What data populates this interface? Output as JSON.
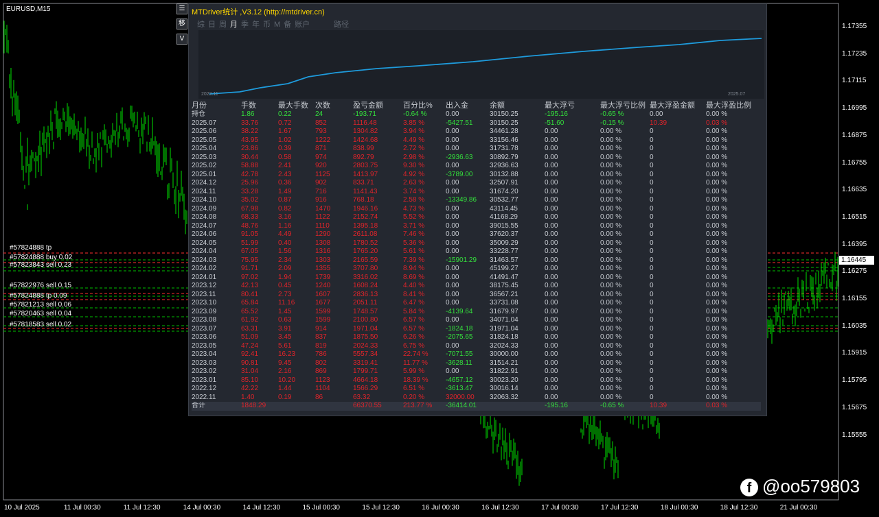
{
  "chart": {
    "symbol": "EURUSD,M15",
    "current_price": "1.16445",
    "price_ticks": [
      "1.17355",
      "1.17235",
      "1.17115",
      "1.16995",
      "1.16875",
      "1.16755",
      "1.16635",
      "1.16515",
      "1.16395",
      "1.16275",
      "1.16155",
      "1.16035",
      "1.15915",
      "1.15795",
      "1.15675",
      "1.15555"
    ],
    "time_ticks": [
      "10 Jul 2025",
      "11 Jul 00:30",
      "11 Jul 12:30",
      "14 Jul 00:30",
      "14 Jul 12:30",
      "15 Jul 00:30",
      "15 Jul 12:30",
      "16 Jul 00:30",
      "16 Jul 12:30",
      "17 Jul 00:30",
      "17 Jul 12:30",
      "18 Jul 00:30",
      "18 Jul 12:30",
      "21 Jul 00:30"
    ],
    "order_labels": [
      "#57824888 tp",
      "#57824888 buy 0.02",
      "#57823843 sell 0.23",
      "#57822976 sell 0.15",
      "#57824888 tp 0.09",
      "#57821213 sell 0.06",
      "#57820463 sell 0.04",
      "#57818583 sell 0.02"
    ],
    "side_buttons": [
      "☰",
      "移",
      "V"
    ],
    "bullish_color": "#00e000",
    "level_color_sell": "#ff3030",
    "level_color_tp": "#00c000"
  },
  "panel": {
    "title": "MTDriver统计 ,V3.12 (http://mtdriver.cn)",
    "tabs": [
      "综",
      "日",
      "周",
      "月",
      "季",
      "年",
      "币",
      "M",
      "备",
      "账户",
      "",
      "路径"
    ],
    "active_tab": "月",
    "mini_chart": {
      "start_label": "2022.11",
      "end_label": "2025.07",
      "line_color": "#1e9bdc"
    },
    "headers": [
      "月份",
      "手数",
      "最大手数",
      "次数",
      "盈亏金额",
      "百分比%",
      "出入金",
      "余额",
      "最大浮亏",
      "最大浮亏比例",
      "最大浮盈金额",
      "最大浮盈比例"
    ],
    "rows": [
      {
        "cells": [
          "持仓",
          "1.86",
          "0.22",
          "24",
          "-193.71",
          "-0.64 %",
          "0.00",
          "30150.25",
          "-195.16",
          "-0.65 %",
          "0.00",
          "0.00 %"
        ],
        "colors": [
          "w",
          "g",
          "g",
          "g",
          "g",
          "g",
          "w",
          "w",
          "g",
          "g",
          "w",
          "w"
        ]
      },
      {
        "cells": [
          "2025.07",
          "33.76",
          "0.72",
          "852",
          "1116.48",
          "3.85 %",
          "-5427.51",
          "30150.25",
          "-51.60",
          "-0.15 %",
          "10.39",
          "0.03 %"
        ],
        "colors": [
          "w",
          "r",
          "r",
          "r",
          "r",
          "r",
          "g",
          "w",
          "g",
          "g",
          "r",
          "r"
        ]
      },
      {
        "cells": [
          "2025.06",
          "38.22",
          "1.67",
          "793",
          "1304.82",
          "3.94 %",
          "0.00",
          "34461.28",
          "0.00",
          "0.00 %",
          "0",
          "0.00 %"
        ],
        "colors": [
          "w",
          "r",
          "r",
          "r",
          "r",
          "r",
          "w",
          "w",
          "w",
          "w",
          "w",
          "w"
        ]
      },
      {
        "cells": [
          "2025.05",
          "43.95",
          "1.02",
          "1222",
          "1424.68",
          "4.49 %",
          "0.00",
          "33156.46",
          "0.00",
          "0.00 %",
          "0",
          "0.00 %"
        ],
        "colors": [
          "w",
          "r",
          "r",
          "r",
          "r",
          "r",
          "w",
          "w",
          "w",
          "w",
          "w",
          "w"
        ]
      },
      {
        "cells": [
          "2025.04",
          "23.86",
          "0.39",
          "871",
          "838.99",
          "2.72 %",
          "0.00",
          "31731.78",
          "0.00",
          "0.00 %",
          "0",
          "0.00 %"
        ],
        "colors": [
          "w",
          "r",
          "r",
          "r",
          "r",
          "r",
          "w",
          "w",
          "w",
          "w",
          "w",
          "w"
        ]
      },
      {
        "cells": [
          "2025.03",
          "30.44",
          "0.58",
          "974",
          "892.79",
          "2.98 %",
          "-2936.63",
          "30892.79",
          "0.00",
          "0.00 %",
          "0",
          "0.00 %"
        ],
        "colors": [
          "w",
          "r",
          "r",
          "r",
          "r",
          "r",
          "g",
          "w",
          "w",
          "w",
          "w",
          "w"
        ]
      },
      {
        "cells": [
          "2025.02",
          "58.88",
          "2.41",
          "920",
          "2803.75",
          "9.30 %",
          "0.00",
          "32936.63",
          "0.00",
          "0.00 %",
          "0",
          "0.00 %"
        ],
        "colors": [
          "w",
          "r",
          "r",
          "r",
          "r",
          "r",
          "w",
          "w",
          "w",
          "w",
          "w",
          "w"
        ]
      },
      {
        "cells": [
          "2025.01",
          "42.78",
          "2.43",
          "1125",
          "1413.97",
          "4.92 %",
          "-3789.00",
          "30132.88",
          "0.00",
          "0.00 %",
          "0",
          "0.00 %"
        ],
        "colors": [
          "w",
          "r",
          "r",
          "r",
          "r",
          "r",
          "g",
          "w",
          "w",
          "w",
          "w",
          "w"
        ]
      },
      {
        "cells": [
          "2024.12",
          "25.96",
          "0.36",
          "902",
          "833.71",
          "2.63 %",
          "0.00",
          "32507.91",
          "0.00",
          "0.00 %",
          "0",
          "0.00 %"
        ],
        "colors": [
          "w",
          "r",
          "r",
          "r",
          "r",
          "r",
          "w",
          "w",
          "w",
          "w",
          "w",
          "w"
        ]
      },
      {
        "cells": [
          "2024.11",
          "33.28",
          "1.49",
          "716",
          "1141.43",
          "3.74 %",
          "0.00",
          "31674.20",
          "0.00",
          "0.00 %",
          "0",
          "0.00 %"
        ],
        "colors": [
          "w",
          "r",
          "r",
          "r",
          "r",
          "r",
          "w",
          "w",
          "w",
          "w",
          "w",
          "w"
        ]
      },
      {
        "cells": [
          "2024.10",
          "35.02",
          "0.87",
          "916",
          "768.18",
          "2.58 %",
          "-13349.86",
          "30532.77",
          "0.00",
          "0.00 %",
          "0",
          "0.00 %"
        ],
        "colors": [
          "w",
          "r",
          "r",
          "r",
          "r",
          "r",
          "g",
          "w",
          "w",
          "w",
          "w",
          "w"
        ]
      },
      {
        "cells": [
          "2024.09",
          "67.98",
          "0.82",
          "1470",
          "1946.16",
          "4.73 %",
          "0.00",
          "43114.45",
          "0.00",
          "0.00 %",
          "0",
          "0.00 %"
        ],
        "colors": [
          "w",
          "r",
          "r",
          "r",
          "r",
          "r",
          "w",
          "w",
          "w",
          "w",
          "w",
          "w"
        ]
      },
      {
        "cells": [
          "2024.08",
          "68.33",
          "3.16",
          "1122",
          "2152.74",
          "5.52 %",
          "0.00",
          "41168.29",
          "0.00",
          "0.00 %",
          "0",
          "0.00 %"
        ],
        "colors": [
          "w",
          "r",
          "r",
          "r",
          "r",
          "r",
          "w",
          "w",
          "w",
          "w",
          "w",
          "w"
        ]
      },
      {
        "cells": [
          "2024.07",
          "48.76",
          "1.16",
          "1110",
          "1395.18",
          "3.71 %",
          "0.00",
          "39015.55",
          "0.00",
          "0.00 %",
          "0",
          "0.00 %"
        ],
        "colors": [
          "w",
          "r",
          "r",
          "r",
          "r",
          "r",
          "w",
          "w",
          "w",
          "w",
          "w",
          "w"
        ]
      },
      {
        "cells": [
          "2024.06",
          "91.05",
          "4.49",
          "1290",
          "2611.08",
          "7.46 %",
          "0.00",
          "37620.37",
          "0.00",
          "0.00 %",
          "0",
          "0.00 %"
        ],
        "colors": [
          "w",
          "r",
          "r",
          "r",
          "r",
          "r",
          "w",
          "w",
          "w",
          "w",
          "w",
          "w"
        ]
      },
      {
        "cells": [
          "2024.05",
          "51.99",
          "0.40",
          "1308",
          "1780.52",
          "5.36 %",
          "0.00",
          "35009.29",
          "0.00",
          "0.00 %",
          "0",
          "0.00 %"
        ],
        "colors": [
          "w",
          "r",
          "r",
          "r",
          "r",
          "r",
          "w",
          "w",
          "w",
          "w",
          "w",
          "w"
        ]
      },
      {
        "cells": [
          "2024.04",
          "67.05",
          "1.56",
          "1316",
          "1765.20",
          "5.61 %",
          "0.00",
          "33228.77",
          "0.00",
          "0.00 %",
          "0",
          "0.00 %"
        ],
        "colors": [
          "w",
          "r",
          "r",
          "r",
          "r",
          "r",
          "w",
          "w",
          "w",
          "w",
          "w",
          "w"
        ]
      },
      {
        "cells": [
          "2024.03",
          "75.95",
          "2.34",
          "1303",
          "2165.59",
          "7.39 %",
          "-15901.29",
          "31463.57",
          "0.00",
          "0.00 %",
          "0",
          "0.00 %"
        ],
        "colors": [
          "w",
          "r",
          "r",
          "r",
          "r",
          "r",
          "g",
          "w",
          "w",
          "w",
          "w",
          "w"
        ]
      },
      {
        "cells": [
          "2024.02",
          "91.71",
          "2.09",
          "1355",
          "3707.80",
          "8.94 %",
          "0.00",
          "45199.27",
          "0.00",
          "0.00 %",
          "0",
          "0.00 %"
        ],
        "colors": [
          "w",
          "r",
          "r",
          "r",
          "r",
          "r",
          "w",
          "w",
          "w",
          "w",
          "w",
          "w"
        ]
      },
      {
        "cells": [
          "2024.01",
          "97.02",
          "1.94",
          "1739",
          "3316.02",
          "8.69 %",
          "0.00",
          "41491.47",
          "0.00",
          "0.00 %",
          "0",
          "0.00 %"
        ],
        "colors": [
          "w",
          "r",
          "r",
          "r",
          "r",
          "r",
          "w",
          "w",
          "w",
          "w",
          "w",
          "w"
        ]
      },
      {
        "cells": [
          "2023.12",
          "42.13",
          "0.45",
          "1240",
          "1608.24",
          "4.40 %",
          "0.00",
          "38175.45",
          "0.00",
          "0.00 %",
          "0",
          "0.00 %"
        ],
        "colors": [
          "w",
          "r",
          "r",
          "r",
          "r",
          "r",
          "w",
          "w",
          "w",
          "w",
          "w",
          "w"
        ]
      },
      {
        "cells": [
          "2023.11",
          "80.41",
          "2.73",
          "1607",
          "2836.13",
          "8.41 %",
          "0.00",
          "36567.21",
          "0.00",
          "0.00 %",
          "0",
          "0.00 %"
        ],
        "colors": [
          "w",
          "r",
          "r",
          "r",
          "r",
          "r",
          "w",
          "w",
          "w",
          "w",
          "w",
          "w"
        ]
      },
      {
        "cells": [
          "2023.10",
          "65.84",
          "11.16",
          "1677",
          "2051.11",
          "6.47 %",
          "0.00",
          "33731.08",
          "0.00",
          "0.00 %",
          "0",
          "0.00 %"
        ],
        "colors": [
          "w",
          "r",
          "r",
          "r",
          "r",
          "r",
          "w",
          "w",
          "w",
          "w",
          "w",
          "w"
        ]
      },
      {
        "cells": [
          "2023.09",
          "65.52",
          "1.45",
          "1599",
          "1748.57",
          "5.84 %",
          "-4139.64",
          "31679.97",
          "0.00",
          "0.00 %",
          "0",
          "0.00 %"
        ],
        "colors": [
          "w",
          "r",
          "r",
          "r",
          "r",
          "r",
          "g",
          "w",
          "w",
          "w",
          "w",
          "w"
        ]
      },
      {
        "cells": [
          "2023.08",
          "61.92",
          "0.63",
          "1599",
          "2100.80",
          "6.57 %",
          "0.00",
          "34071.04",
          "0.00",
          "0.00 %",
          "0",
          "0.00 %"
        ],
        "colors": [
          "w",
          "r",
          "r",
          "r",
          "r",
          "r",
          "w",
          "w",
          "w",
          "w",
          "w",
          "w"
        ]
      },
      {
        "cells": [
          "2023.07",
          "63.31",
          "3.91",
          "914",
          "1971.04",
          "6.57 %",
          "-1824.18",
          "31971.04",
          "0.00",
          "0.00 %",
          "0",
          "0.00 %"
        ],
        "colors": [
          "w",
          "r",
          "r",
          "r",
          "r",
          "r",
          "g",
          "w",
          "w",
          "w",
          "w",
          "w"
        ]
      },
      {
        "cells": [
          "2023.06",
          "51.09",
          "3.45",
          "837",
          "1875.50",
          "6.26 %",
          "-2075.65",
          "31824.18",
          "0.00",
          "0.00 %",
          "0",
          "0.00 %"
        ],
        "colors": [
          "w",
          "r",
          "r",
          "r",
          "r",
          "r",
          "g",
          "w",
          "w",
          "w",
          "w",
          "w"
        ]
      },
      {
        "cells": [
          "2023.05",
          "47.24",
          "5.61",
          "819",
          "2024.33",
          "6.75 %",
          "0.00",
          "32024.33",
          "0.00",
          "0.00 %",
          "0",
          "0.00 %"
        ],
        "colors": [
          "w",
          "r",
          "r",
          "r",
          "r",
          "r",
          "w",
          "w",
          "w",
          "w",
          "w",
          "w"
        ]
      },
      {
        "cells": [
          "2023.04",
          "92.41",
          "16.23",
          "786",
          "5557.34",
          "22.74 %",
          "-7071.55",
          "30000.00",
          "0.00",
          "0.00 %",
          "0",
          "0.00 %"
        ],
        "colors": [
          "w",
          "r",
          "r",
          "r",
          "r",
          "r",
          "g",
          "w",
          "w",
          "w",
          "w",
          "w"
        ]
      },
      {
        "cells": [
          "2023.03",
          "90.81",
          "9.45",
          "802",
          "3319.41",
          "11.77 %",
          "-3628.11",
          "31514.21",
          "0.00",
          "0.00 %",
          "0",
          "0.00 %"
        ],
        "colors": [
          "w",
          "r",
          "r",
          "r",
          "r",
          "r",
          "g",
          "w",
          "w",
          "w",
          "w",
          "w"
        ]
      },
      {
        "cells": [
          "2023.02",
          "31.04",
          "2.16",
          "869",
          "1799.71",
          "5.99 %",
          "0.00",
          "31822.91",
          "0.00",
          "0.00 %",
          "0",
          "0.00 %"
        ],
        "colors": [
          "w",
          "r",
          "r",
          "r",
          "r",
          "r",
          "w",
          "w",
          "w",
          "w",
          "w",
          "w"
        ]
      },
      {
        "cells": [
          "2023.01",
          "85.10",
          "10.20",
          "1123",
          "4664.18",
          "18.39 %",
          "-4657.12",
          "30023.20",
          "0.00",
          "0.00 %",
          "0",
          "0.00 %"
        ],
        "colors": [
          "w",
          "r",
          "r",
          "r",
          "r",
          "r",
          "g",
          "w",
          "w",
          "w",
          "w",
          "w"
        ]
      },
      {
        "cells": [
          "2022.12",
          "42.22",
          "1.44",
          "1104",
          "1566.29",
          "6.51 %",
          "-3613.47",
          "30016.14",
          "0.00",
          "0.00 %",
          "0",
          "0.00 %"
        ],
        "colors": [
          "w",
          "r",
          "r",
          "r",
          "r",
          "r",
          "g",
          "w",
          "w",
          "w",
          "w",
          "w"
        ]
      },
      {
        "cells": [
          "2022.11",
          "1.40",
          "0.19",
          "86",
          "63.32",
          "0.20 %",
          "32000.00",
          "32063.32",
          "0.00",
          "0.00 %",
          "0",
          "0.00 %"
        ],
        "colors": [
          "w",
          "r",
          "r",
          "r",
          "r",
          "r",
          "r",
          "w",
          "w",
          "w",
          "w",
          "w"
        ]
      }
    ],
    "total": {
      "cells": [
        "合计",
        "1848.29",
        "",
        "",
        "66370.55",
        "213.77 %",
        "-36414.01",
        "",
        "-195.16",
        "-0.65 %",
        "10.39",
        "0.03 %"
      ],
      "colors": [
        "w",
        "r",
        "r",
        "r",
        "r",
        "r",
        "g",
        "w",
        "g",
        "g",
        "r",
        "r"
      ]
    }
  },
  "watermark": {
    "icon": "f",
    "text": "@oo579803"
  }
}
